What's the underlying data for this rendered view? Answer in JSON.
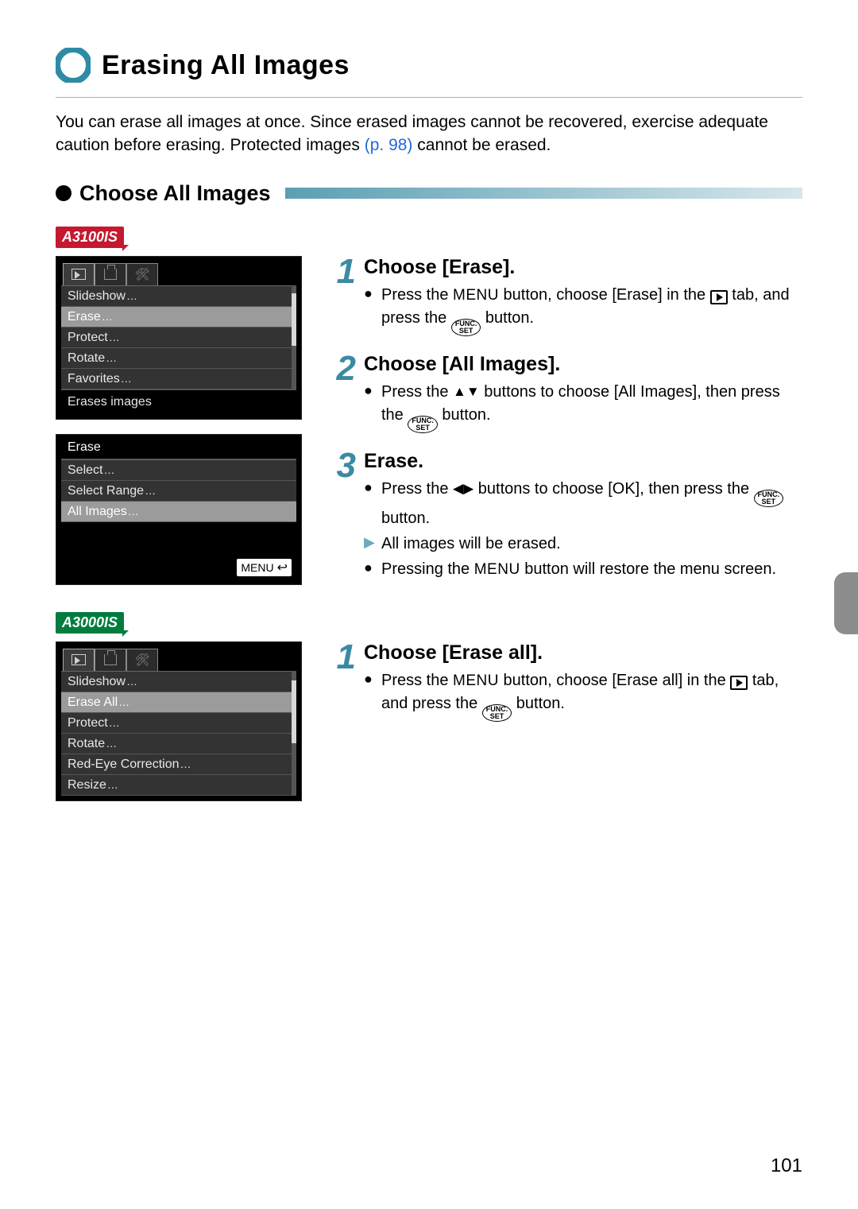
{
  "title": "Erasing All Images",
  "intro": {
    "t1": "You can erase all images at once. Since erased images cannot be recovered, exercise adequate caution before erasing. Protected images ",
    "link": "(p. 98)",
    "t2": " cannot be erased."
  },
  "section_heading": "Choose All Images",
  "badges": {
    "a3100": "A3100IS",
    "a3000": "A3000IS"
  },
  "screens": {
    "menu1": {
      "items": [
        "Slideshow",
        "Erase",
        "Protect",
        "Rotate",
        "Favorites"
      ],
      "selected": 1,
      "desc": "Erases images"
    },
    "menu2": {
      "title": "Erase",
      "items": [
        "Select",
        "Select Range",
        "All Images"
      ],
      "selected": 2,
      "menu_btn": "MENU"
    },
    "menu3": {
      "items": [
        "Slideshow",
        "Erase All",
        "Protect",
        "Rotate",
        "Red-Eye Correction",
        "Resize"
      ],
      "selected": 1
    }
  },
  "stepsA": [
    {
      "num": "1",
      "title": "Choose [Erase].",
      "bullets": [
        {
          "kind": "dot",
          "frags": [
            "Press the ",
            "MENU",
            " button, choose [Erase] in the ",
            "PLAY",
            " tab, and press the ",
            "FUNC",
            " button."
          ]
        }
      ]
    },
    {
      "num": "2",
      "title": "Choose [All Images].",
      "bullets": [
        {
          "kind": "dot",
          "frags": [
            "Press the ",
            "UPDOWN",
            " buttons to choose [All Images], then press the ",
            "FUNC",
            " button."
          ]
        }
      ]
    },
    {
      "num": "3",
      "title": "Erase.",
      "bullets": [
        {
          "kind": "dot",
          "frags": [
            "Press the ",
            "LEFTRIGHT",
            " buttons to choose [OK], then press the ",
            "FUNC",
            " button."
          ]
        },
        {
          "kind": "tri",
          "frags": [
            "All images will be erased."
          ]
        },
        {
          "kind": "dot",
          "frags": [
            "Pressing the ",
            "MENU",
            " button will restore the menu screen."
          ]
        }
      ]
    }
  ],
  "stepsB": [
    {
      "num": "1",
      "title": "Choose [Erase all].",
      "bullets": [
        {
          "kind": "dot",
          "frags": [
            "Press the ",
            "MENU",
            " button, choose [Erase all] in the ",
            "PLAY",
            " tab, and press the ",
            "FUNC",
            " button."
          ]
        }
      ]
    }
  ],
  "page_number": "101"
}
